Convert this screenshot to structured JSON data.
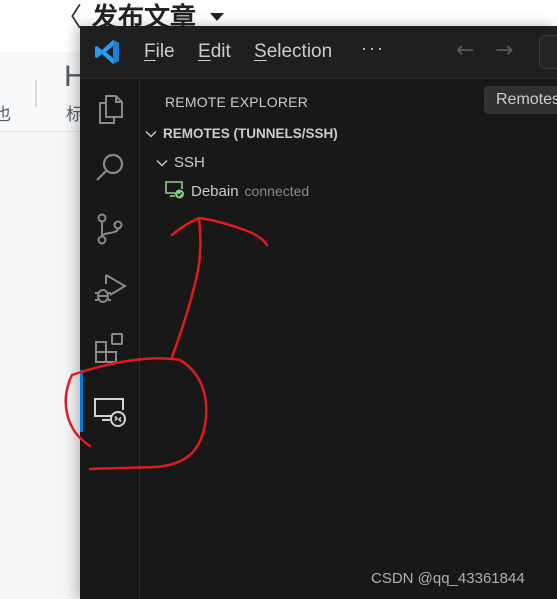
{
  "background_page": {
    "back_glyph": "〈",
    "title": "发布文章",
    "toolbar_heading_glyph": "H",
    "toolbar_label_left": "也",
    "toolbar_label_heading": "标"
  },
  "vscode": {
    "menu": {
      "file": {
        "mnemonic": "F",
        "rest": "ile"
      },
      "edit": {
        "mnemonic": "E",
        "rest": "dit"
      },
      "selection": {
        "mnemonic": "S",
        "rest": "election"
      },
      "more": "···"
    },
    "nav": {
      "back": "←",
      "forward": "→"
    },
    "activity_bar": [
      {
        "name": "explorer",
        "active": false
      },
      {
        "name": "search",
        "active": false
      },
      {
        "name": "source-control",
        "active": false
      },
      {
        "name": "run-and-debug",
        "active": false
      },
      {
        "name": "extensions",
        "active": false
      },
      {
        "name": "remote-explorer",
        "active": true
      }
    ],
    "sidebar": {
      "title": "REMOTE EXPLORER",
      "view_picker": "Remotes",
      "section": "REMOTES (TUNNELS/SSH)",
      "group": "SSH",
      "hosts": [
        {
          "name": "Debain",
          "status": "connected",
          "status_color": "#89d185"
        }
      ]
    },
    "accent_color": "#0078d4"
  },
  "annotation_color": "#e01b1b",
  "watermark": "CSDN @qq_43361844"
}
